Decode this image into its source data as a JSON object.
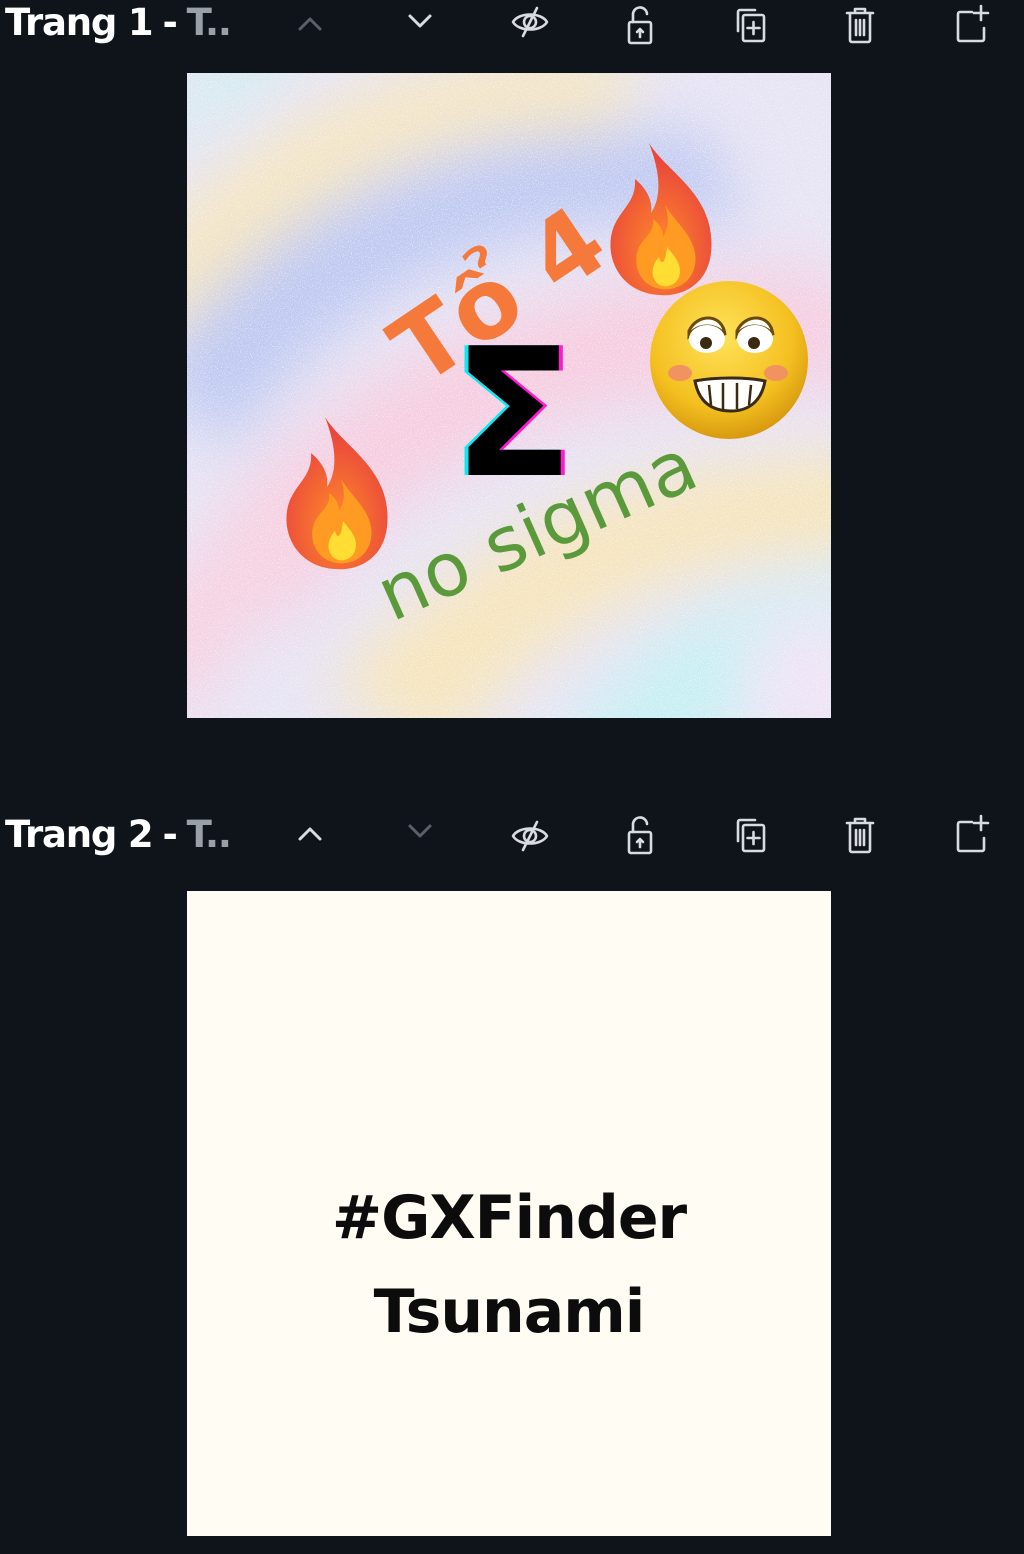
{
  "pages": [
    {
      "name": "Trang 1",
      "separator": "-",
      "subtitle": "T..",
      "controls": {
        "move_up": "disabled",
        "move_down": "enabled",
        "hide": "enabled",
        "lock": "enabled",
        "duplicate": "enabled",
        "delete": "enabled",
        "add_page": "enabled"
      },
      "thumbnail": {
        "title_text": "Tổ 4",
        "symbol": "Σ",
        "tagline": "no sigma",
        "colors": {
          "title": "#f5793a",
          "symbol": "#000000",
          "tagline": "#5a9a3a"
        }
      }
    },
    {
      "name": "Trang 2",
      "separator": "-",
      "subtitle": "T..",
      "controls": {
        "move_up": "enabled",
        "move_down": "disabled",
        "hide": "enabled",
        "lock": "enabled",
        "duplicate": "enabled",
        "delete": "enabled",
        "add_page": "enabled"
      },
      "thumbnail": {
        "line1": "#GXFinder",
        "line2": "Tsunami",
        "background": "#fffdf3"
      }
    }
  ],
  "theme": {
    "panel_background": "#0f141b",
    "icon_active": "#d8dbe0",
    "icon_disabled": "#5a6069"
  }
}
